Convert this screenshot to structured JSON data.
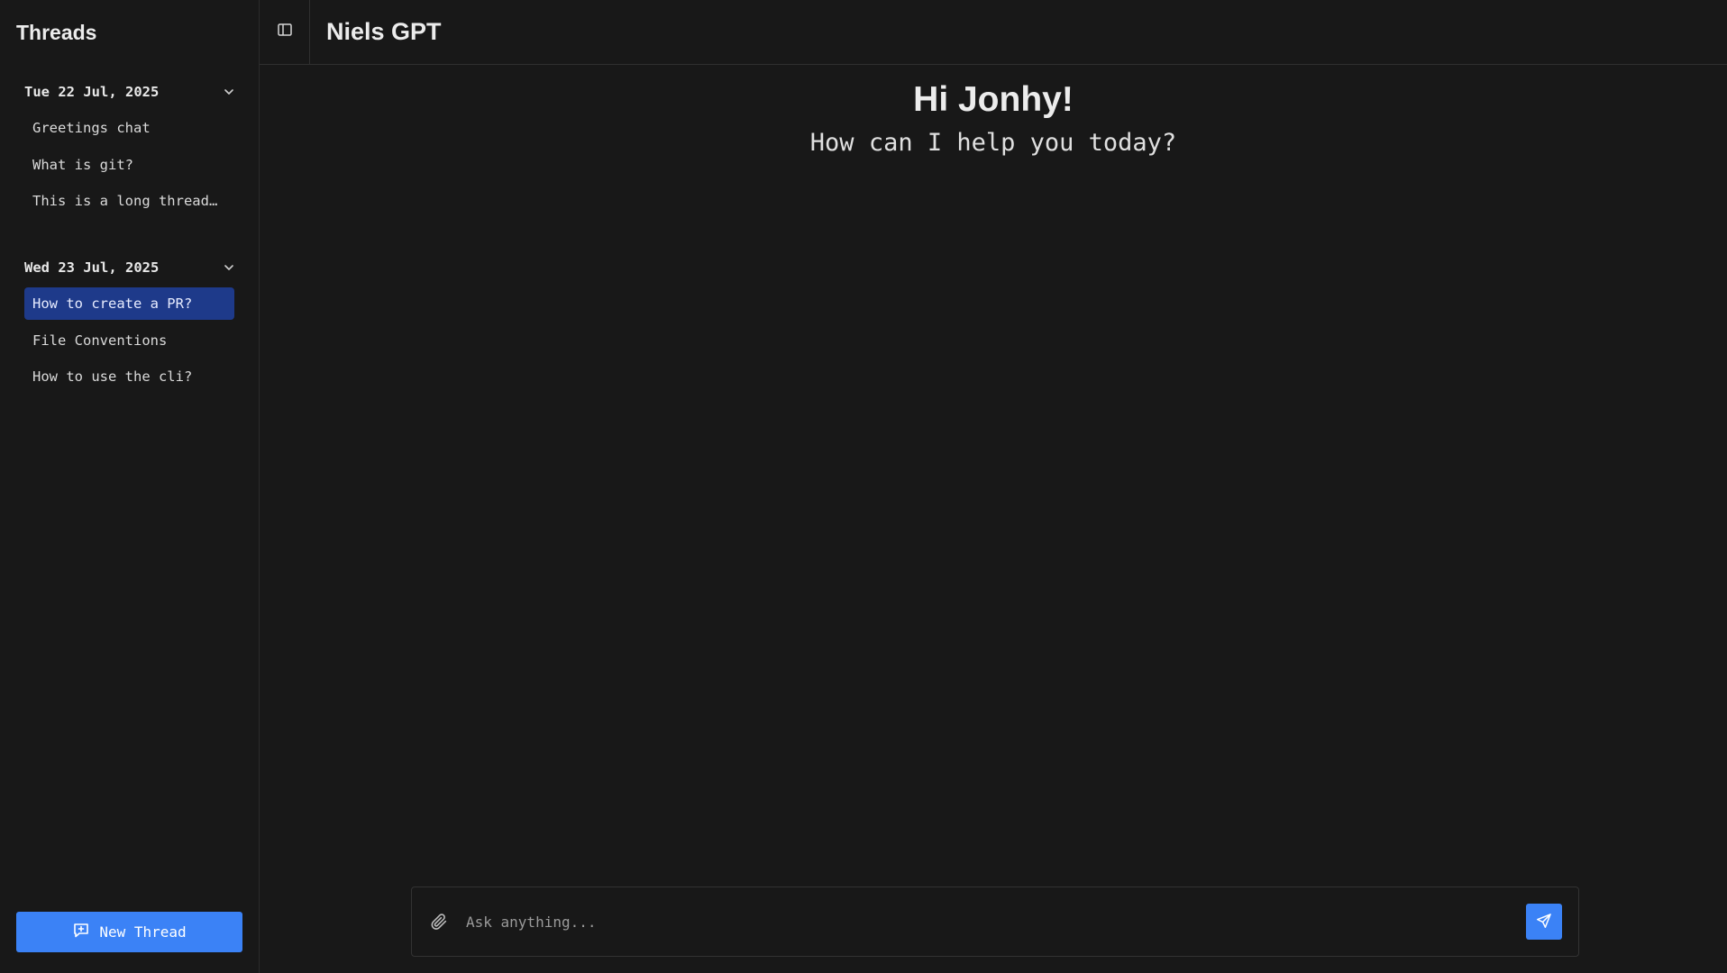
{
  "sidebar": {
    "title": "Threads",
    "groups": [
      {
        "date": "Tue 22 Jul, 2025",
        "items": [
          {
            "label": "Greetings chat"
          },
          {
            "label": "What is git?"
          },
          {
            "label": "This is a long thread…"
          }
        ]
      },
      {
        "date": "Wed 23 Jul, 2025",
        "items": [
          {
            "label": "How to create a PR?"
          },
          {
            "label": "File Conventions"
          },
          {
            "label": "How to use the cli?"
          }
        ]
      }
    ],
    "new_thread_label": "New Thread"
  },
  "header": {
    "title": "Niels GPT"
  },
  "main": {
    "greeting_title": "Hi Jonhy!",
    "greeting_subtitle": "How can I help you today?"
  },
  "composer": {
    "placeholder": "Ask anything..."
  },
  "colors": {
    "background": "#181818",
    "accent": "#3b82f6",
    "active_item": "#1e3a8a"
  }
}
